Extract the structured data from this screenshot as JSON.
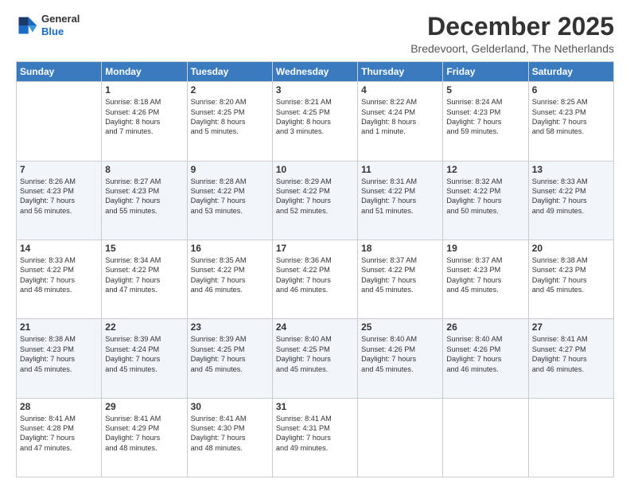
{
  "logo": {
    "line1": "General",
    "line2": "Blue"
  },
  "header": {
    "month": "December 2025",
    "location": "Bredevoort, Gelderland, The Netherlands"
  },
  "weekdays": [
    "Sunday",
    "Monday",
    "Tuesday",
    "Wednesday",
    "Thursday",
    "Friday",
    "Saturday"
  ],
  "weeks": [
    [
      {
        "day": "",
        "info": ""
      },
      {
        "day": "1",
        "info": "Sunrise: 8:18 AM\nSunset: 4:26 PM\nDaylight: 8 hours\nand 7 minutes."
      },
      {
        "day": "2",
        "info": "Sunrise: 8:20 AM\nSunset: 4:25 PM\nDaylight: 8 hours\nand 5 minutes."
      },
      {
        "day": "3",
        "info": "Sunrise: 8:21 AM\nSunset: 4:25 PM\nDaylight: 8 hours\nand 3 minutes."
      },
      {
        "day": "4",
        "info": "Sunrise: 8:22 AM\nSunset: 4:24 PM\nDaylight: 8 hours\nand 1 minute."
      },
      {
        "day": "5",
        "info": "Sunrise: 8:24 AM\nSunset: 4:23 PM\nDaylight: 7 hours\nand 59 minutes."
      },
      {
        "day": "6",
        "info": "Sunrise: 8:25 AM\nSunset: 4:23 PM\nDaylight: 7 hours\nand 58 minutes."
      }
    ],
    [
      {
        "day": "7",
        "info": "Sunrise: 8:26 AM\nSunset: 4:23 PM\nDaylight: 7 hours\nand 56 minutes."
      },
      {
        "day": "8",
        "info": "Sunrise: 8:27 AM\nSunset: 4:23 PM\nDaylight: 7 hours\nand 55 minutes."
      },
      {
        "day": "9",
        "info": "Sunrise: 8:28 AM\nSunset: 4:22 PM\nDaylight: 7 hours\nand 53 minutes."
      },
      {
        "day": "10",
        "info": "Sunrise: 8:29 AM\nSunset: 4:22 PM\nDaylight: 7 hours\nand 52 minutes."
      },
      {
        "day": "11",
        "info": "Sunrise: 8:31 AM\nSunset: 4:22 PM\nDaylight: 7 hours\nand 51 minutes."
      },
      {
        "day": "12",
        "info": "Sunrise: 8:32 AM\nSunset: 4:22 PM\nDaylight: 7 hours\nand 50 minutes."
      },
      {
        "day": "13",
        "info": "Sunrise: 8:33 AM\nSunset: 4:22 PM\nDaylight: 7 hours\nand 49 minutes."
      }
    ],
    [
      {
        "day": "14",
        "info": "Sunrise: 8:33 AM\nSunset: 4:22 PM\nDaylight: 7 hours\nand 48 minutes."
      },
      {
        "day": "15",
        "info": "Sunrise: 8:34 AM\nSunset: 4:22 PM\nDaylight: 7 hours\nand 47 minutes."
      },
      {
        "day": "16",
        "info": "Sunrise: 8:35 AM\nSunset: 4:22 PM\nDaylight: 7 hours\nand 46 minutes."
      },
      {
        "day": "17",
        "info": "Sunrise: 8:36 AM\nSunset: 4:22 PM\nDaylight: 7 hours\nand 46 minutes."
      },
      {
        "day": "18",
        "info": "Sunrise: 8:37 AM\nSunset: 4:22 PM\nDaylight: 7 hours\nand 45 minutes."
      },
      {
        "day": "19",
        "info": "Sunrise: 8:37 AM\nSunset: 4:23 PM\nDaylight: 7 hours\nand 45 minutes."
      },
      {
        "day": "20",
        "info": "Sunrise: 8:38 AM\nSunset: 4:23 PM\nDaylight: 7 hours\nand 45 minutes."
      }
    ],
    [
      {
        "day": "21",
        "info": "Sunrise: 8:38 AM\nSunset: 4:23 PM\nDaylight: 7 hours\nand 45 minutes."
      },
      {
        "day": "22",
        "info": "Sunrise: 8:39 AM\nSunset: 4:24 PM\nDaylight: 7 hours\nand 45 minutes."
      },
      {
        "day": "23",
        "info": "Sunrise: 8:39 AM\nSunset: 4:25 PM\nDaylight: 7 hours\nand 45 minutes."
      },
      {
        "day": "24",
        "info": "Sunrise: 8:40 AM\nSunset: 4:25 PM\nDaylight: 7 hours\nand 45 minutes."
      },
      {
        "day": "25",
        "info": "Sunrise: 8:40 AM\nSunset: 4:26 PM\nDaylight: 7 hours\nand 45 minutes."
      },
      {
        "day": "26",
        "info": "Sunrise: 8:40 AM\nSunset: 4:26 PM\nDaylight: 7 hours\nand 46 minutes."
      },
      {
        "day": "27",
        "info": "Sunrise: 8:41 AM\nSunset: 4:27 PM\nDaylight: 7 hours\nand 46 minutes."
      }
    ],
    [
      {
        "day": "28",
        "info": "Sunrise: 8:41 AM\nSunset: 4:28 PM\nDaylight: 7 hours\nand 47 minutes."
      },
      {
        "day": "29",
        "info": "Sunrise: 8:41 AM\nSunset: 4:29 PM\nDaylight: 7 hours\nand 48 minutes."
      },
      {
        "day": "30",
        "info": "Sunrise: 8:41 AM\nSunset: 4:30 PM\nDaylight: 7 hours\nand 48 minutes."
      },
      {
        "day": "31",
        "info": "Sunrise: 8:41 AM\nSunset: 4:31 PM\nDaylight: 7 hours\nand 49 minutes."
      },
      {
        "day": "",
        "info": ""
      },
      {
        "day": "",
        "info": ""
      },
      {
        "day": "",
        "info": ""
      }
    ]
  ]
}
